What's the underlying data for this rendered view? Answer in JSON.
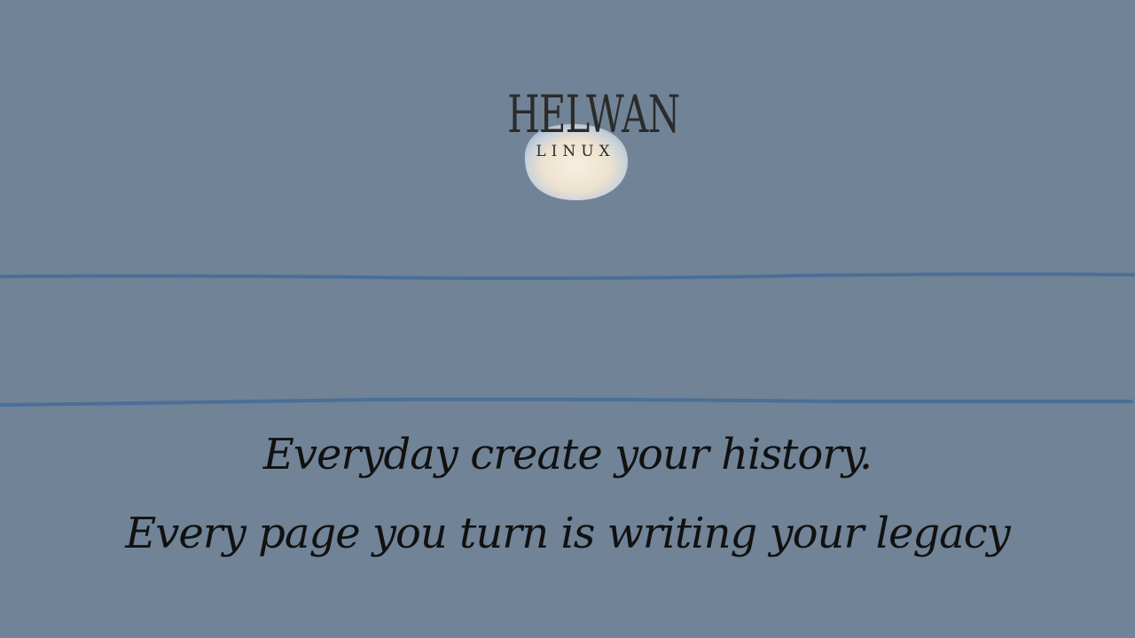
{
  "brand": {
    "name": "HELWAN",
    "subtitle": "LINUX"
  },
  "quote": {
    "line1": "Everyday create your history.",
    "line2": "Every page you turn is writing your legacy"
  },
  "colors": {
    "background": "#718396",
    "rule": "#4a6f98",
    "text": "#111111",
    "moon": "#f2ebdc"
  }
}
